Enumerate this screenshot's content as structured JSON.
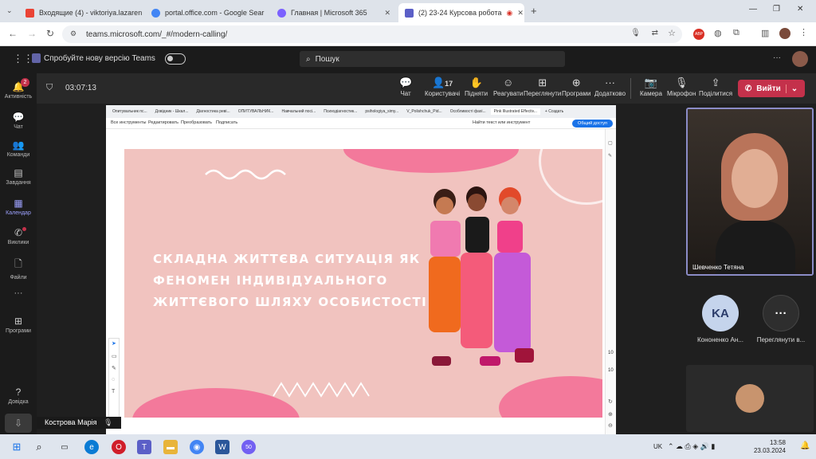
{
  "browser": {
    "tabs": [
      {
        "label": "Входящие (4) - viktoriya.lazaren",
        "icon": "gmail-icon",
        "color": "#ea4335"
      },
      {
        "label": "portal.office.com - Google Sear",
        "icon": "google-icon",
        "color": "#4285f4"
      },
      {
        "label": "Главная | Microsoft 365",
        "icon": "microsoft365-icon",
        "color": "#7b61ff"
      },
      {
        "label": "(2) 23-24 Курсова робота",
        "icon": "teams-icon",
        "color": "#5b5fc7"
      }
    ],
    "url": "teams.microsoft.com/_#/modern-calling/"
  },
  "teams": {
    "new_version_label": "Спробуйте нову версію Teams",
    "search_placeholder": "Пошук",
    "more_label": "···"
  },
  "rail": [
    {
      "label": "Активність",
      "icon": "bell-icon",
      "badge": "2"
    },
    {
      "label": "Чат",
      "icon": "chat-icon"
    },
    {
      "label": "Команди",
      "icon": "teams-group-icon"
    },
    {
      "label": "Завдання",
      "icon": "assignments-icon"
    },
    {
      "label": "Календар",
      "icon": "calendar-icon",
      "active": true
    },
    {
      "label": "Виклики",
      "icon": "phone-icon",
      "dot": true
    },
    {
      "label": "Файли",
      "icon": "file-icon"
    },
    {
      "label": "···",
      "icon": "more-icon"
    },
    {
      "label": "Програми",
      "icon": "apps-icon"
    },
    {
      "label": "Довідка",
      "icon": "help-icon"
    }
  ],
  "meeting": {
    "timer": "03:07:13",
    "participants_count": "17",
    "buttons": [
      {
        "label": "Чат",
        "icon": "chat-icon"
      },
      {
        "label": "Користувачі",
        "icon": "people-icon"
      },
      {
        "label": "Підняти",
        "icon": "hand-icon"
      },
      {
        "label": "Реагувати",
        "icon": "emoji-icon"
      },
      {
        "label": "Переглянути",
        "icon": "view-icon"
      },
      {
        "label": "Програми",
        "icon": "apps-icon"
      },
      {
        "label": "Додатково",
        "icon": "more-icon"
      },
      {
        "label": "Камера",
        "icon": "camera-off-icon"
      },
      {
        "label": "Мікрофон",
        "icon": "mic-icon"
      },
      {
        "label": "Поділитися",
        "icon": "share-icon"
      }
    ],
    "leave_label": "Вийти"
  },
  "shared_screen": {
    "tabs": [
      "Опитувальник пс...",
      "Довідник - Шкал...",
      "Діагностика реві...",
      "ОПИТУВАЛЬНИК...",
      "Навчальний посі...",
      "Психодіагностик...",
      "psihologiya_simy...",
      "V_Polishchuk_Pid...",
      "Особливості фахі...",
      "Pink Illustrated Effectiv...",
      "+ Создать"
    ],
    "tools": [
      "Все инструменты",
      "Редактировать",
      "Преобразовать",
      "Подписать"
    ],
    "search_text": "Найти текст или инструмент",
    "share_button": "Общий доступ",
    "page_number": "10",
    "page_total": "10",
    "slide_title_lines": [
      "СКЛАДНА ЖИТТЄВА СИТУАЦІЯ ЯК",
      "ФЕНОМЕН ІНДИВІДУАЛЬНОГО",
      "ЖИТТЄВОГО ШЛЯХУ ОСОБИСТОСТІ"
    ]
  },
  "participants": {
    "main_video_name": "Шевченко Тетяна",
    "others": [
      {
        "initials": "KA",
        "name": "Кононенко Ан...",
        "color": "#c5d4ec"
      },
      {
        "initials": "···",
        "name": "Переглянути в...",
        "color": "#2e2e2e"
      }
    ]
  },
  "presenter_tag": "Кострова Марія",
  "taskbar": {
    "language": "UK",
    "time": "13:58",
    "date": "23.03.2024",
    "teams_badge": "50"
  }
}
